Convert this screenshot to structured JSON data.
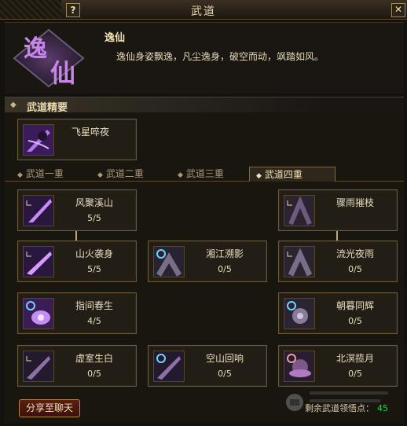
{
  "window": {
    "title": "武道",
    "help_label": "?",
    "close_label": "✕"
  },
  "header": {
    "emblem_text": "逸仙",
    "name": "逸仙",
    "description": "逸仙身姿飘逸，凡尘逸身，破空而动，飒踏如风。"
  },
  "section": {
    "title": "武道精要"
  },
  "essential_skill": {
    "name": "飞星啐夜"
  },
  "tabs": [
    {
      "label": "武道一重",
      "active": false
    },
    {
      "label": "武道二重",
      "active": false
    },
    {
      "label": "武道三重",
      "active": false
    },
    {
      "label": "武道四重",
      "active": true
    }
  ],
  "skills": {
    "r1c1": {
      "name": "风聚溪山",
      "level": "5/5"
    },
    "r1c3": {
      "name": "骤雨摧枝",
      "level": ""
    },
    "r2c1": {
      "name": "山火袭身",
      "level": "5/5"
    },
    "r2c2": {
      "name": "湘江溯影",
      "level": "0/5"
    },
    "r2c3": {
      "name": "流光夜雨",
      "level": "0/5"
    },
    "r3c1": {
      "name": "指间春生",
      "level": "4/5"
    },
    "r3c3": {
      "name": "朝暮同辉",
      "level": "0/5"
    },
    "r4c1": {
      "name": "虚室生白",
      "level": "0/5"
    },
    "r4c2": {
      "name": "空山回响",
      "level": "0/5"
    },
    "r4c3": {
      "name": "北溟揽月",
      "level": "0/5"
    }
  },
  "footer": {
    "share_label": "分享至聊天",
    "points_label": "剩余武道领悟点：",
    "points_value": "45"
  },
  "colors": {
    "accent": "#e9d8ae",
    "frame": "#6a583a",
    "points": "#2ed04a"
  }
}
